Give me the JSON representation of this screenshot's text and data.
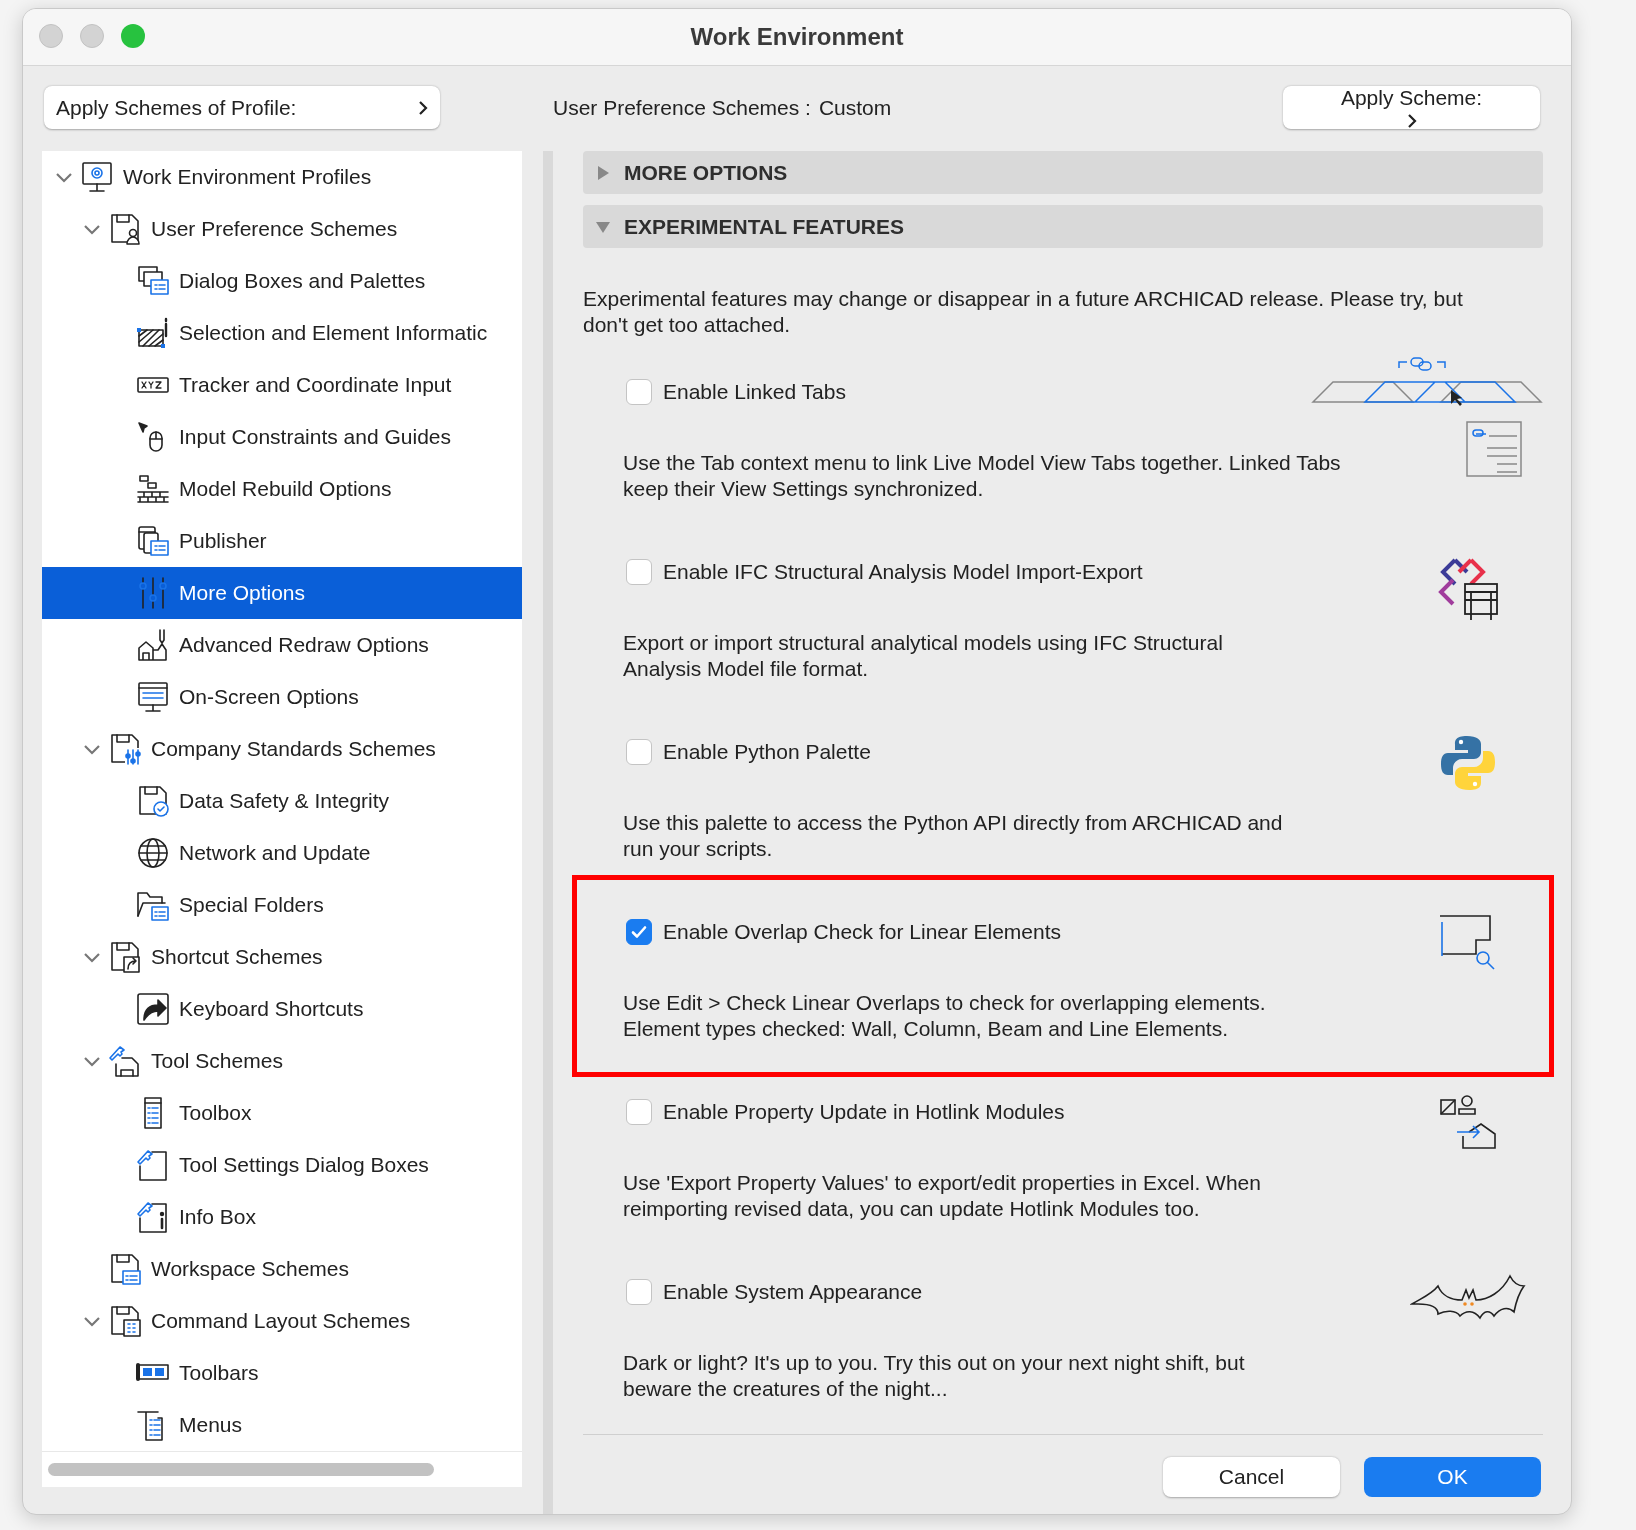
{
  "window": {
    "title": "Work Environment"
  },
  "top_bar": {
    "profile_button": "Apply Schemes of Profile:",
    "scheme_label": "User Preference Schemes :",
    "scheme_value": "Custom",
    "scheme_button": "Apply Scheme:"
  },
  "tree": [
    {
      "label": "Work Environment Profiles",
      "expanded": true,
      "selected": false,
      "children": [
        {
          "label": "User Preference Schemes",
          "expanded": true,
          "selected": false,
          "children": [
            {
              "label": "Dialog Boxes and Palettes",
              "selected": false
            },
            {
              "label": "Selection and Element Informatic",
              "selected": false
            },
            {
              "label": "Tracker and Coordinate Input",
              "selected": false
            },
            {
              "label": "Input Constraints and Guides",
              "selected": false
            },
            {
              "label": "Model Rebuild Options",
              "selected": false
            },
            {
              "label": "Publisher",
              "selected": false
            },
            {
              "label": "More Options",
              "selected": true
            },
            {
              "label": "Advanced Redraw Options",
              "selected": false
            },
            {
              "label": "On-Screen Options",
              "selected": false
            }
          ]
        },
        {
          "label": "Company Standards Schemes",
          "expanded": true,
          "selected": false,
          "children": [
            {
              "label": "Data Safety & Integrity",
              "selected": false
            },
            {
              "label": "Network and Update",
              "selected": false
            },
            {
              "label": "Special Folders",
              "selected": false
            }
          ]
        },
        {
          "label": "Shortcut Schemes",
          "expanded": true,
          "selected": false,
          "children": [
            {
              "label": "Keyboard Shortcuts",
              "selected": false
            }
          ]
        },
        {
          "label": "Tool Schemes",
          "expanded": true,
          "selected": false,
          "children": [
            {
              "label": "Toolbox",
              "selected": false
            },
            {
              "label": "Tool Settings Dialog Boxes",
              "selected": false
            },
            {
              "label": "Info Box",
              "selected": false
            }
          ]
        },
        {
          "label": "Workspace Schemes",
          "selected": false
        },
        {
          "label": "Command Layout Schemes",
          "expanded": true,
          "selected": false,
          "children": [
            {
              "label": "Toolbars",
              "selected": false
            },
            {
              "label": "Menus",
              "selected": false
            }
          ]
        }
      ]
    }
  ],
  "sections": [
    {
      "title": "MORE OPTIONS",
      "expanded": false
    },
    {
      "title": "EXPERIMENTAL FEATURES",
      "expanded": true
    }
  ],
  "intro": "Experimental features may change or disappear in a future ARCHICAD release. Please try, but don't get too attached.",
  "features": [
    {
      "title": "Enable Linked Tabs",
      "checked": false,
      "highlighted": false,
      "description_lines": [
        "Use the Tab context menu to link Live Model View Tabs together. Linked Tabs",
        "keep their View Settings synchronized."
      ]
    },
    {
      "title": "Enable IFC Structural Analysis Model Import-Export",
      "checked": false,
      "highlighted": false,
      "description_lines": [
        "Export or import structural analytical models using IFC Structural",
        "Analysis Model file format."
      ]
    },
    {
      "title": "Enable Python Palette",
      "checked": false,
      "highlighted": false,
      "description_lines": [
        "Use this palette to access the Python API directly from ARCHICAD and",
        "run your scripts."
      ]
    },
    {
      "title": "Enable Overlap Check for Linear Elements",
      "checked": true,
      "highlighted": true,
      "description_lines": [
        "Use Edit > Check Linear Overlaps to check for overlapping elements.",
        "Element types checked: Wall, Column, Beam and Line Elements."
      ]
    },
    {
      "title": "Enable Property Update in Hotlink Modules",
      "checked": false,
      "highlighted": false,
      "description_lines": [
        "Use 'Export Property Values' to export/edit properties in Excel. When",
        "reimporting revised data, you can update Hotlink Modules too."
      ]
    },
    {
      "title": "Enable System Appearance",
      "checked": false,
      "highlighted": false,
      "description_lines": [
        "Dark or light? It's up to you. Try this out on your next night shift, but",
        "beware the creatures of the night..."
      ]
    }
  ],
  "buttons": [
    {
      "label": "Cancel",
      "kind": "secondary"
    },
    {
      "label": "OK",
      "kind": "primary"
    }
  ]
}
